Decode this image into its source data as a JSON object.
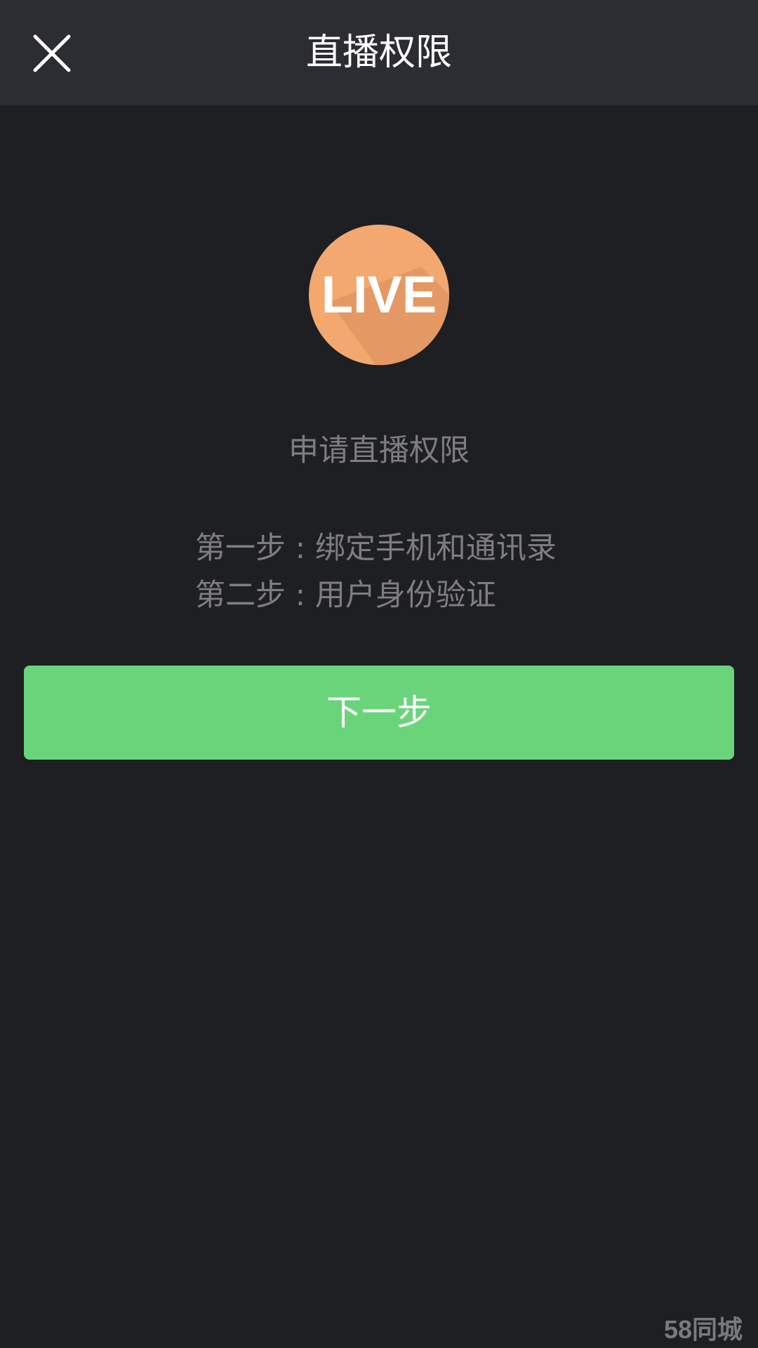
{
  "header": {
    "title": "直播权限",
    "close_icon": "close-icon"
  },
  "logo": {
    "text": "LIVE",
    "colors": {
      "circle": "#f2a86f",
      "shadow": "#d98a5a",
      "text": "#ffffff"
    }
  },
  "content": {
    "apply_title": "申请直播权限",
    "steps": [
      "第一步 : 绑定手机和通讯录",
      "第二步 : 用户身份验证"
    ]
  },
  "actions": {
    "next_label": "下一步",
    "next_color": "#6ad47b"
  },
  "watermark": {
    "text": "58同城"
  }
}
